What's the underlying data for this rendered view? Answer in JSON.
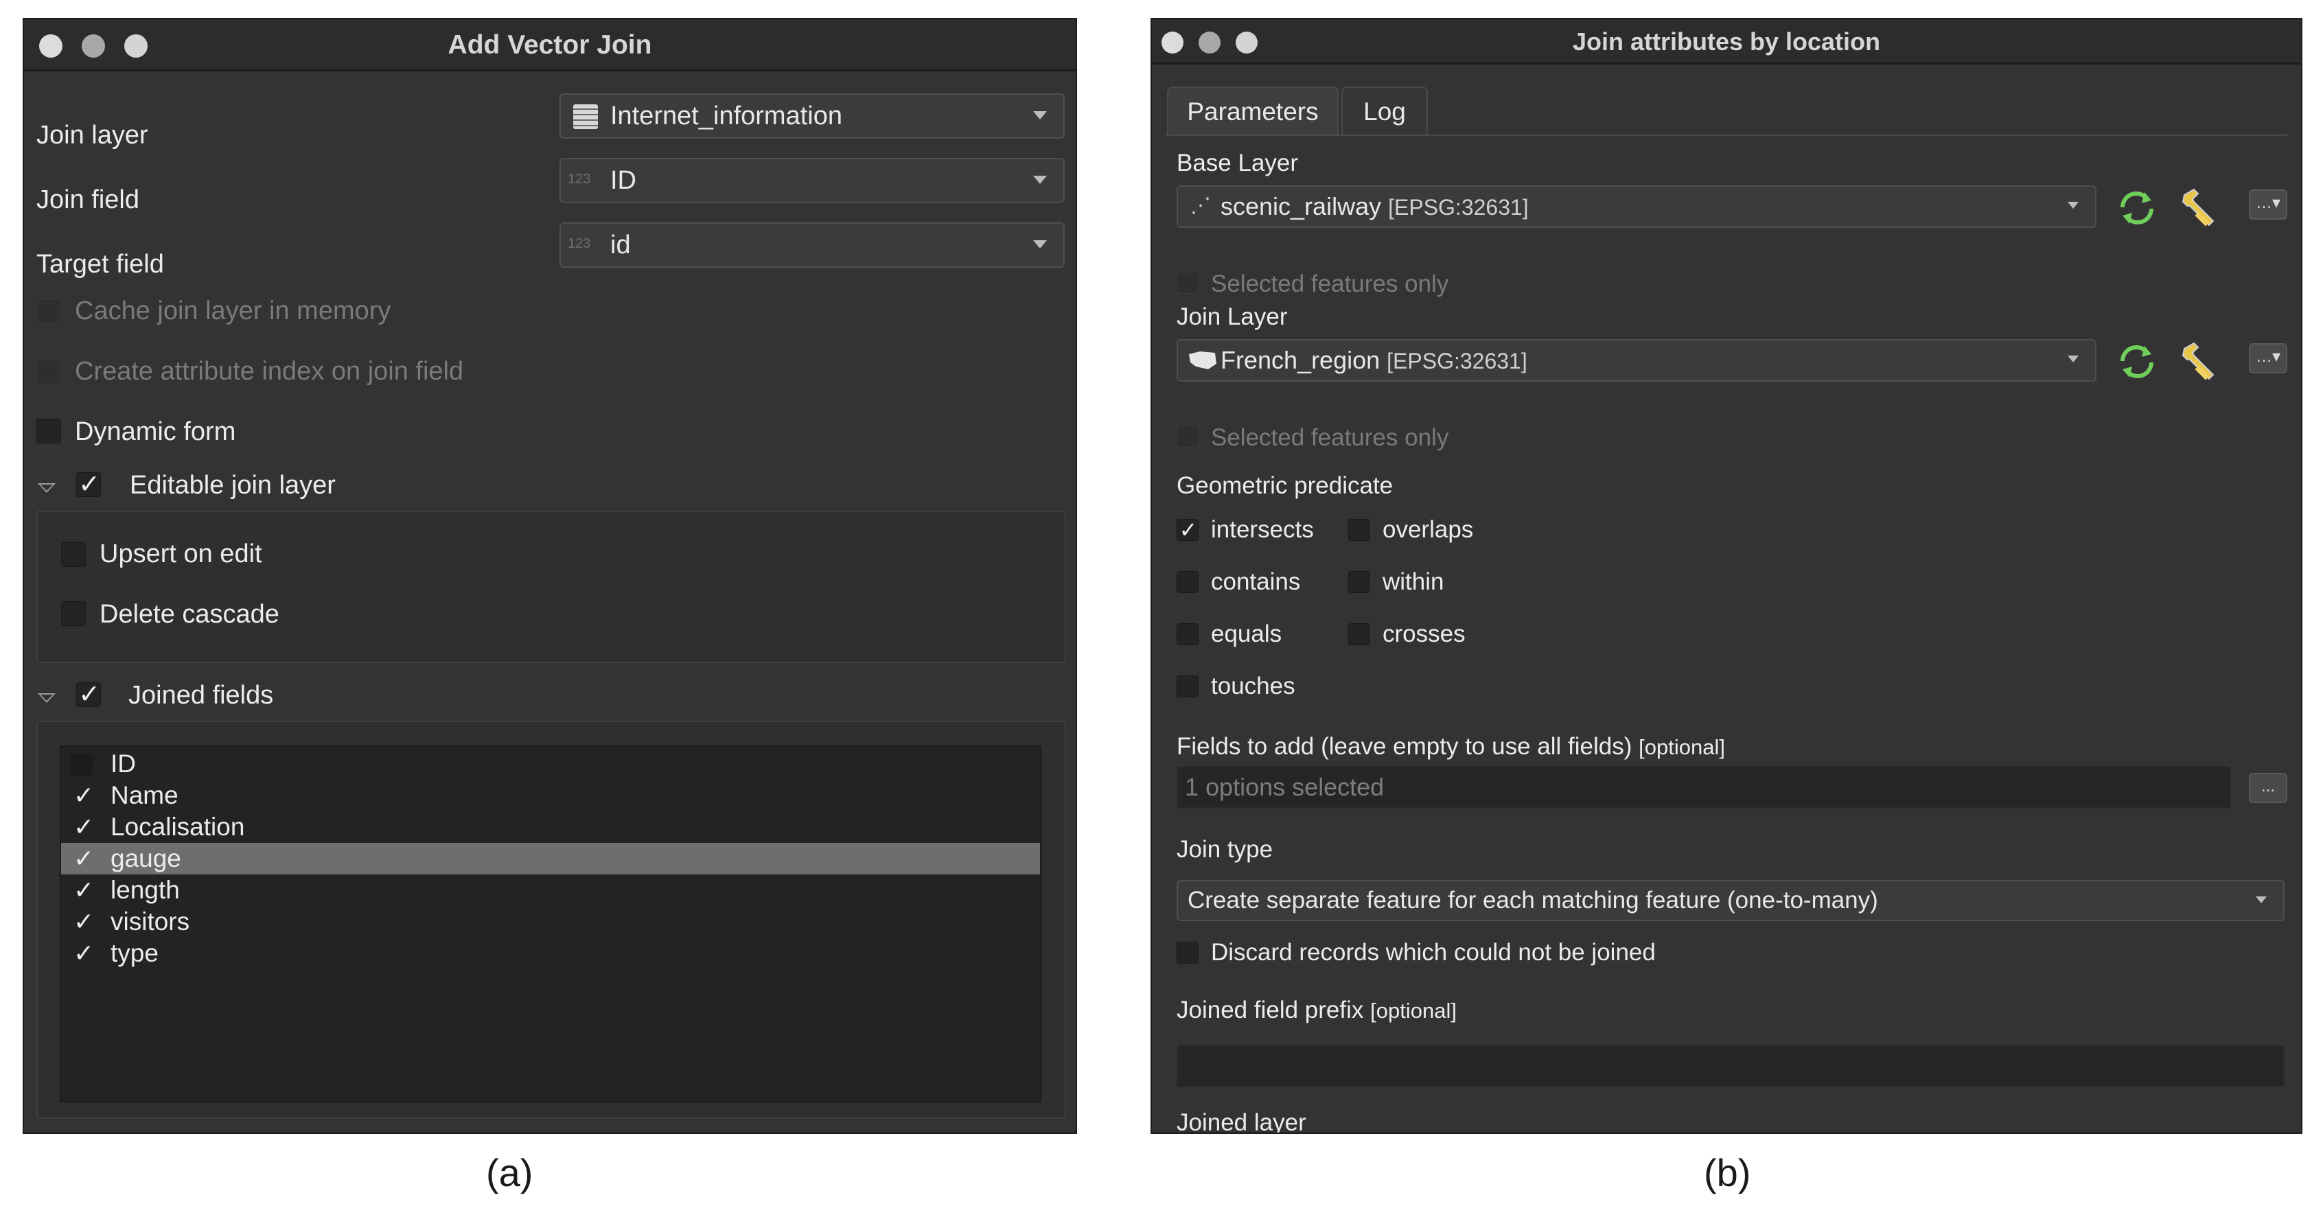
{
  "panel_a": {
    "title": "Add Vector Join",
    "join_layer_label": "Join layer",
    "join_layer_value": "Internet_information",
    "join_field_label": "Join field",
    "join_field_value": "ID",
    "target_field_label": "Target field",
    "target_field_value": "id",
    "field_type_tag": "123",
    "cache_join_layer": "Cache join layer in memory",
    "create_attribute_index": "Create attribute index on join field",
    "dynamic_form": "Dynamic form",
    "editable_join_layer": "Editable join layer",
    "upsert_on_edit": "Upsert on edit",
    "delete_cascade": "Delete cascade",
    "joined_fields": "Joined fields",
    "fields": [
      {
        "name": "ID",
        "checked": false
      },
      {
        "name": "Name",
        "checked": true
      },
      {
        "name": "Localisation",
        "checked": true
      },
      {
        "name": "gauge",
        "checked": true
      },
      {
        "name": "length",
        "checked": true
      },
      {
        "name": "visitors",
        "checked": true
      },
      {
        "name": "type",
        "checked": true
      }
    ],
    "selected_field": "gauge",
    "check_glyph": "✓"
  },
  "panel_b": {
    "title": "Join attributes by location",
    "tabs": [
      "Parameters",
      "Log"
    ],
    "base_layer_label": "Base Layer",
    "base_layer_value": "scenic_railway",
    "base_layer_crs": "[EPSG:32631]",
    "selected_features_only": "Selected features only",
    "join_layer_label": "Join Layer",
    "join_layer_value": "French_region",
    "join_layer_crs": "[EPSG:32631]",
    "geometric_predicate_label": "Geometric predicate",
    "predicates": {
      "intersects": "intersects",
      "overlaps": "overlaps",
      "contains": "contains",
      "within": "within",
      "equals": "equals",
      "crosses": "crosses",
      "touches": "touches"
    },
    "fields_to_add_label": "Fields to add (leave empty to use all fields)",
    "optional_tag": "[optional]",
    "fields_to_add_placeholder": "1 options selected",
    "join_type_label": "Join type",
    "join_type_value": "Create separate feature for each matching feature (one-to-many)",
    "discard_records": "Discard records which could not be joined",
    "joined_field_prefix_label": "Joined field prefix",
    "joined_layer_label": "Joined layer",
    "ellipsis": "...",
    "ellipsis_dropdown": "…▾",
    "check_glyph": "✓",
    "accent_green": "#6fcf5a",
    "wrench_yellow": "#e8c64a"
  },
  "captions": [
    "(a)",
    "(b)"
  ]
}
